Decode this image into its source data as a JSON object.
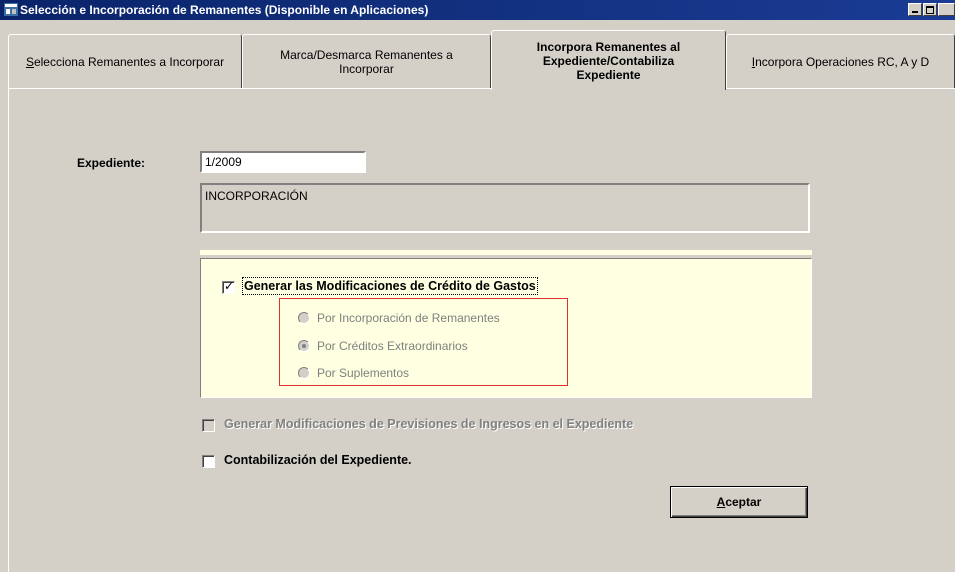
{
  "window": {
    "title": "Selección e Incorporación de Remanentes (Disponible en Aplicaciones)"
  },
  "tabs": [
    {
      "label_ul": "S",
      "label_rest": "elecciona Remanentes a Incorporar",
      "active": false
    },
    {
      "label": "Marca/Desmarca Remanentes a Incorporar",
      "active": false
    },
    {
      "label": "Incorpora Remanentes al Expediente/Contabiliza Expediente",
      "active": true
    },
    {
      "label_ul": "I",
      "label_rest": "ncorpora Operaciones RC, A y D",
      "active": false
    }
  ],
  "form": {
    "expediente_label": "Expediente:",
    "expediente_value": "1/2009",
    "description": "INCORPORACIÓN",
    "generar_gastos": {
      "label": "Generar las Modificaciones de Crédito de Gastos",
      "checked": true
    },
    "options": [
      {
        "label": "Por Incorporación de Remanentes",
        "checked": false
      },
      {
        "label": "Por Créditos Extraordinarios",
        "checked": true
      },
      {
        "label": "Por Suplementos",
        "checked": false
      }
    ],
    "generar_ingresos": {
      "label": "Generar Modificaciones de Previsiones de Ingresos en el Expediente",
      "checked": false
    },
    "contabilizacion": {
      "label": "Contabilización del Expediente.",
      "checked": false
    },
    "accept_ul": "A",
    "accept_rest": "ceptar"
  },
  "colors": {
    "titlebar": "#0a246a",
    "panel": "#ffffe1",
    "highlight_border": "#e03030"
  }
}
